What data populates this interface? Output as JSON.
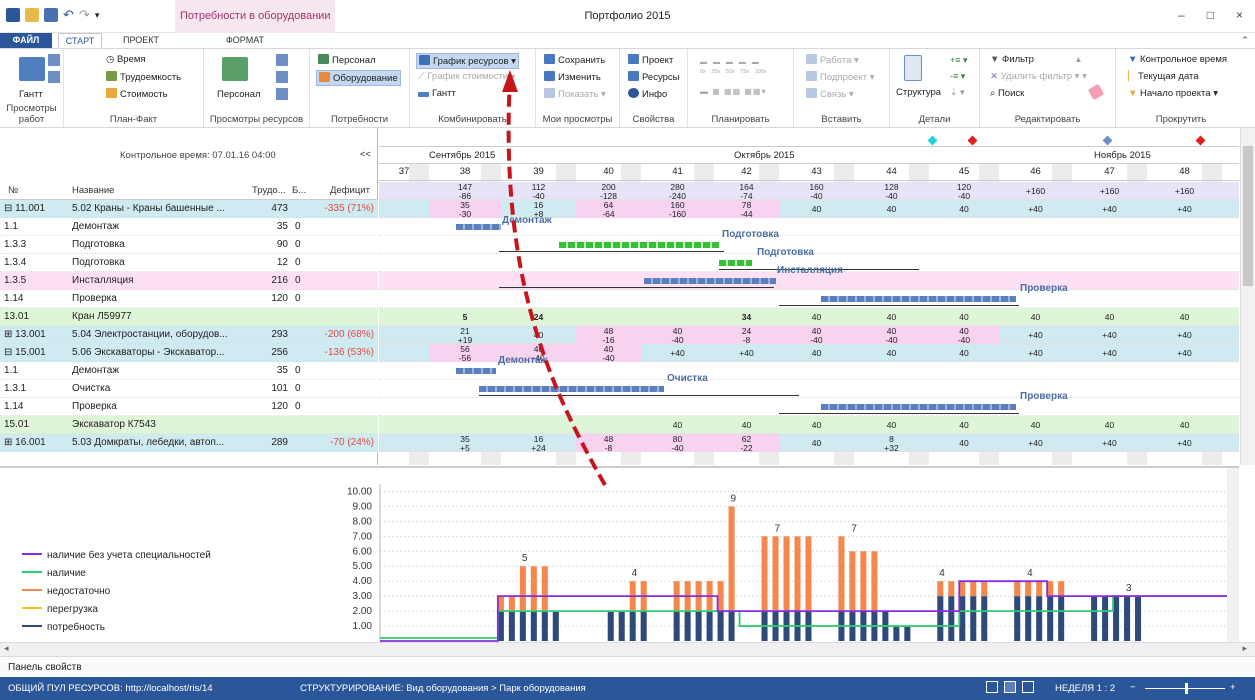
{
  "window": {
    "title": "Портфолио 2015",
    "context_tab_group": "Потребности в оборудовании",
    "min": "–",
    "max": "□",
    "close": "×"
  },
  "tabs": {
    "file": "ФАЙЛ",
    "start": "СТАРТ",
    "project": "ПРОЕКТ",
    "format": "ФОРМАТ"
  },
  "ribbon": {
    "g1": {
      "label": "Просмотры работ",
      "gantt": "Гантт"
    },
    "g2": {
      "label": "План-Факт",
      "time": "Время",
      "labor": "Трудоемкость",
      "cost": "Стоимость"
    },
    "g3": {
      "label": "Просмотры ресурсов",
      "personnel": "Персонал"
    },
    "g4": {
      "label": "Потребности",
      "personnel": "Персонал",
      "equipment": "Оборудование"
    },
    "g5": {
      "label": "Комбинировать",
      "resource_chart": "График ресурсов",
      "cost_chart": "График стоимости",
      "gantt": "Гантт"
    },
    "g6": {
      "label": "Мои просмотры",
      "save": "Сохранить",
      "change": "Изменить",
      "show": "Показать"
    },
    "g7": {
      "label": "Свойства",
      "project": "Проект",
      "resources": "Ресурсы",
      "info": "Инфо"
    },
    "g8": {
      "label": "Планировать",
      "pct": [
        "0x",
        "25x",
        "50x",
        "75x",
        "100x"
      ]
    },
    "g9": {
      "label": "Вставить",
      "work": "Работа",
      "subproject": "Подпроект",
      "link": "Связь"
    },
    "g10": {
      "label": "Детали",
      "structure": "Структура"
    },
    "g11": {
      "label": "Редактировать",
      "filter": "Фильтр",
      "remove_filter": "Удалить фильтр",
      "search": "Поиск"
    },
    "g12": {
      "label": "Прокрутить",
      "baseline": "Контрольное время",
      "current": "Текущая дата",
      "start": "Начало проекта"
    }
  },
  "grid": {
    "baseline_time": "Контрольное время: 07.01.16 04:00",
    "collapse": "<<",
    "headers": {
      "num": "№",
      "name": "Название",
      "labor": "Трудо...",
      "b": "Б...",
      "deficit": "Дефицит"
    },
    "rows": [
      {
        "num": "⊟ 11.001",
        "name": "5.02 Краны - Краны башенные ...",
        "labor": "473",
        "b": "",
        "deficit": "-335 (71%)"
      },
      {
        "num": "1.1",
        "name": "Демонтаж",
        "labor": "35",
        "b": "0",
        "deficit": ""
      },
      {
        "num": "1.3.3",
        "name": "Подготовка",
        "labor": "90",
        "b": "0",
        "deficit": ""
      },
      {
        "num": "1.3.4",
        "name": "Подготовка",
        "labor": "12",
        "b": "0",
        "deficit": ""
      },
      {
        "num": "1.3.5",
        "name": "Инсталляция",
        "labor": "216",
        "b": "0",
        "deficit": ""
      },
      {
        "num": "1.14",
        "name": "Проверка",
        "labor": "120",
        "b": "0",
        "deficit": ""
      },
      {
        "num": "13.01",
        "name": "Кран Л59977",
        "labor": "",
        "b": "",
        "deficit": ""
      },
      {
        "num": "⊞ 13.001",
        "name": "5.04 Электростанции, оборудов...",
        "labor": "293",
        "b": "",
        "deficit": "-200 (68%)"
      },
      {
        "num": "⊟ 15.001",
        "name": "5.06 Экскаваторы - Экскаватор...",
        "labor": "256",
        "b": "",
        "deficit": "-136 (53%)"
      },
      {
        "num": "1.1",
        "name": "Демонтаж",
        "labor": "35",
        "b": "0",
        "deficit": ""
      },
      {
        "num": "1.3.1",
        "name": "Очистка",
        "labor": "101",
        "b": "0",
        "deficit": ""
      },
      {
        "num": "1.14",
        "name": "Проверка",
        "labor": "120",
        "b": "0",
        "deficit": ""
      },
      {
        "num": "15.01",
        "name": "Экскаватор К7543",
        "labor": "",
        "b": "",
        "deficit": ""
      },
      {
        "num": "⊞ 16.001",
        "name": "5.03 Домкраты, лебедки, автоп...",
        "labor": "289",
        "b": "",
        "deficit": "-70 (24%)"
      }
    ]
  },
  "timeline": {
    "months": [
      "Сентябрь 2015",
      "Октябрь 2015",
      "Ноябрь 2015"
    ],
    "weeks": [
      "37",
      "38",
      "39",
      "40",
      "41",
      "42",
      "43",
      "44",
      "45",
      "46",
      "47",
      "48"
    ],
    "summary": [
      [
        "",
        ""
      ],
      [
        "147",
        "-86"
      ],
      [
        "112",
        "-40"
      ],
      [
        "200",
        "-128"
      ],
      [
        "280",
        "-240"
      ],
      [
        "164",
        "-74"
      ],
      [
        "160",
        "-40"
      ],
      [
        "128",
        "-40"
      ],
      [
        "120",
        "-40"
      ],
      [
        "+160",
        ""
      ],
      [
        "+160",
        ""
      ],
      [
        "+160",
        ""
      ]
    ],
    "r11": [
      [
        "",
        ""
      ],
      [
        "35",
        "-30"
      ],
      [
        "16",
        "+8"
      ],
      [
        "64",
        "-64"
      ],
      [
        "160",
        "-160"
      ],
      [
        "78",
        "-44"
      ],
      [
        "40",
        ""
      ],
      [
        "40",
        ""
      ],
      [
        "40",
        ""
      ],
      [
        "+40",
        ""
      ],
      [
        "+40",
        ""
      ],
      [
        "+40",
        ""
      ]
    ],
    "r13_01": [
      "",
      "5",
      "24",
      "",
      "",
      "34",
      "40",
      "40",
      "40",
      "40",
      "40",
      "40"
    ],
    "r13_001": [
      [
        "",
        ""
      ],
      [
        "21",
        "+19"
      ],
      [
        "40",
        ""
      ],
      [
        "48",
        "-16"
      ],
      [
        "40",
        "-40"
      ],
      [
        "24",
        "-8"
      ],
      [
        "40",
        "-40"
      ],
      [
        "40",
        "-40"
      ],
      [
        "40",
        "-40"
      ],
      [
        "+40",
        ""
      ],
      [
        "+40",
        ""
      ],
      [
        "+40",
        ""
      ]
    ],
    "r15_001": [
      [
        "",
        ""
      ],
      [
        "56",
        "-56"
      ],
      [
        "40",
        "-40"
      ],
      [
        "40",
        "-40"
      ],
      [
        "+40",
        ""
      ],
      [
        "+40",
        ""
      ],
      [
        "40",
        ""
      ],
      [
        "40",
        ""
      ],
      [
        "40",
        ""
      ],
      [
        "+40",
        ""
      ],
      [
        "+40",
        ""
      ],
      [
        "+40",
        ""
      ]
    ],
    "r15_01": [
      "",
      "",
      "",
      "",
      "40",
      "40",
      "40",
      "40",
      "40",
      "40",
      "40",
      "40"
    ],
    "r16": [
      [
        "",
        ""
      ],
      [
        "35",
        "+5"
      ],
      [
        "16",
        "+24"
      ],
      [
        "48",
        "-8"
      ],
      [
        "80",
        "-40"
      ],
      [
        "62",
        "-22"
      ],
      [
        "40",
        ""
      ],
      [
        "8",
        "+32"
      ],
      [
        "40",
        ""
      ],
      [
        "+40",
        ""
      ],
      [
        "+40",
        ""
      ],
      [
        "+40",
        ""
      ]
    ],
    "labels": {
      "demontage": "Демонтаж",
      "prep": "Подготовка",
      "install": "Инсталляция",
      "check": "Проверка",
      "cleaning": "Очистка"
    }
  },
  "chart": {
    "legend": [
      {
        "label": "наличие без учета специальностей",
        "color": "#8a2be2"
      },
      {
        "label": "наличие",
        "color": "#2ecc71"
      },
      {
        "label": "недостаточно",
        "color": "#f4874b"
      },
      {
        "label": "перегрузка",
        "color": "#f0c020"
      },
      {
        "label": "потребность",
        "color": "#2e4a7a"
      }
    ],
    "yticks": [
      "10.00",
      "9.00",
      "8.00",
      "7.00",
      "6.00",
      "5.00",
      "4.00",
      "3.00",
      "2.00",
      "1.00"
    ],
    "peak_labels": [
      "5",
      "4",
      "9",
      "7",
      "7",
      "4",
      "4",
      "3"
    ]
  },
  "chart_data": {
    "type": "bar",
    "ylim": [
      0,
      10.5
    ],
    "bars": [
      [
        0,
        0
      ],
      [
        0,
        0
      ],
      [
        0,
        0
      ],
      [
        0,
        0
      ],
      [
        0,
        0
      ],
      [
        0,
        0
      ],
      [
        0,
        0
      ],
      [
        0,
        0
      ],
      [
        0,
        0
      ],
      [
        0,
        0
      ],
      [
        2,
        1
      ],
      [
        2,
        1
      ],
      [
        2,
        3
      ],
      [
        2,
        3
      ],
      [
        2,
        3
      ],
      [
        2,
        0
      ],
      [
        0,
        0
      ],
      [
        0,
        0
      ],
      [
        0,
        0
      ],
      [
        0,
        0
      ],
      [
        2,
        0
      ],
      [
        2,
        0
      ],
      [
        2,
        2
      ],
      [
        2,
        2
      ],
      [
        0,
        0
      ],
      [
        0,
        0
      ],
      [
        2,
        2
      ],
      [
        2,
        2
      ],
      [
        2,
        2
      ],
      [
        2,
        2
      ],
      [
        2,
        2
      ],
      [
        2,
        7
      ],
      [
        0,
        0
      ],
      [
        0,
        0
      ],
      [
        2,
        5
      ],
      [
        2,
        5
      ],
      [
        2,
        5
      ],
      [
        2,
        5
      ],
      [
        2,
        5
      ],
      [
        0,
        0
      ],
      [
        0,
        0
      ],
      [
        2,
        5
      ],
      [
        2,
        4
      ],
      [
        2,
        4
      ],
      [
        2,
        4
      ],
      [
        2,
        0
      ],
      [
        1,
        0
      ],
      [
        1,
        0
      ],
      [
        0,
        0
      ],
      [
        0,
        0
      ],
      [
        3,
        1
      ],
      [
        3,
        1
      ],
      [
        3,
        1
      ],
      [
        3,
        1
      ],
      [
        3,
        1
      ],
      [
        0,
        0
      ],
      [
        0,
        0
      ],
      [
        3,
        1
      ],
      [
        3,
        1
      ],
      [
        3,
        1
      ],
      [
        3,
        1
      ],
      [
        3,
        1
      ],
      [
        0,
        0
      ],
      [
        0,
        0
      ],
      [
        3,
        0
      ],
      [
        3,
        0
      ],
      [
        3,
        0
      ],
      [
        3,
        0
      ],
      [
        3,
        0
      ],
      [
        0,
        0
      ]
    ],
    "purple": [
      [
        0,
        0
      ],
      [
        10,
        3
      ],
      [
        30,
        2
      ],
      [
        40,
        2
      ],
      [
        50,
        2
      ],
      [
        52,
        4
      ],
      [
        60,
        3
      ],
      [
        78,
        3
      ],
      [
        90,
        3.3
      ],
      [
        92,
        4
      ],
      [
        140,
        4
      ]
    ],
    "green": [
      [
        0,
        0.2
      ],
      [
        10,
        2
      ],
      [
        30,
        2
      ],
      [
        32,
        1
      ],
      [
        50,
        1
      ],
      [
        52,
        2
      ],
      [
        66,
        3
      ],
      [
        70,
        3
      ],
      [
        90,
        2
      ],
      [
        92,
        1
      ],
      [
        140,
        1
      ]
    ]
  },
  "status": {
    "pool": "ОБЩИЙ ПУЛ РЕСУРСОВ: http://localhost/ris/14",
    "structuring": "СТРУКТУРИРОВАНИЕ: Вид оборудования > Парк оборудования",
    "week": "НЕДЕЛЯ 1 : 2"
  },
  "properties_panel": "Панель свойств"
}
